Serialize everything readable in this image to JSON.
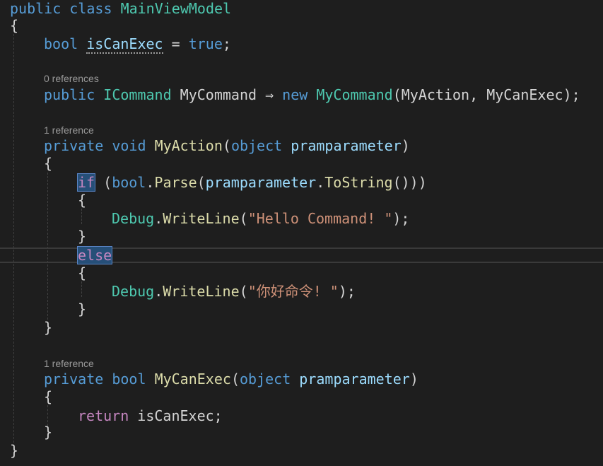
{
  "code": {
    "class_decl": {
      "kw_public": "public",
      "kw_class": "class",
      "name": "MainViewModel"
    },
    "brace_open": "{",
    "brace_close": "}",
    "field": {
      "type": "bool",
      "name": "isCanExec",
      "eq": " = ",
      "value": "true",
      "semi": ";"
    },
    "lens_command": "0 references",
    "command_prop": {
      "kw_public": "public",
      "type": "ICommand",
      "name": "MyCommand",
      "arrow": " ⇒ ",
      "kw_new": "new",
      "ctor": "MyCommand",
      "arg1": "MyAction",
      "arg2": "MyCanExec",
      "tail": ");"
    },
    "lens_action": "1 reference",
    "action_method": {
      "kw_private": "private",
      "kw_void": "void",
      "name": "MyAction",
      "param_type": "object",
      "param_name": "pramparameter"
    },
    "if_stmt": {
      "kw_if": "if",
      "type_bool": "bool",
      "fn_parse": "Parse",
      "param": "pramparameter",
      "fn_tostring": "ToString",
      "tail": "()))"
    },
    "write_hello": {
      "cls": "Debug",
      "fn": "WriteLine",
      "str": "\"Hello Command! \"",
      "tail": ");"
    },
    "kw_else": "else",
    "write_nihao": {
      "cls": "Debug",
      "fn": "WriteLine",
      "str": "\"你好命令! \"",
      "tail": ");"
    },
    "lens_canexec": "1 reference",
    "canexec_method": {
      "kw_private": "private",
      "kw_bool": "bool",
      "name": "MyCanExec",
      "param_type": "object",
      "param_name": "pramparameter"
    },
    "return_stmt": {
      "kw_return": "return",
      "value": "isCanExec",
      "semi": ";"
    }
  }
}
